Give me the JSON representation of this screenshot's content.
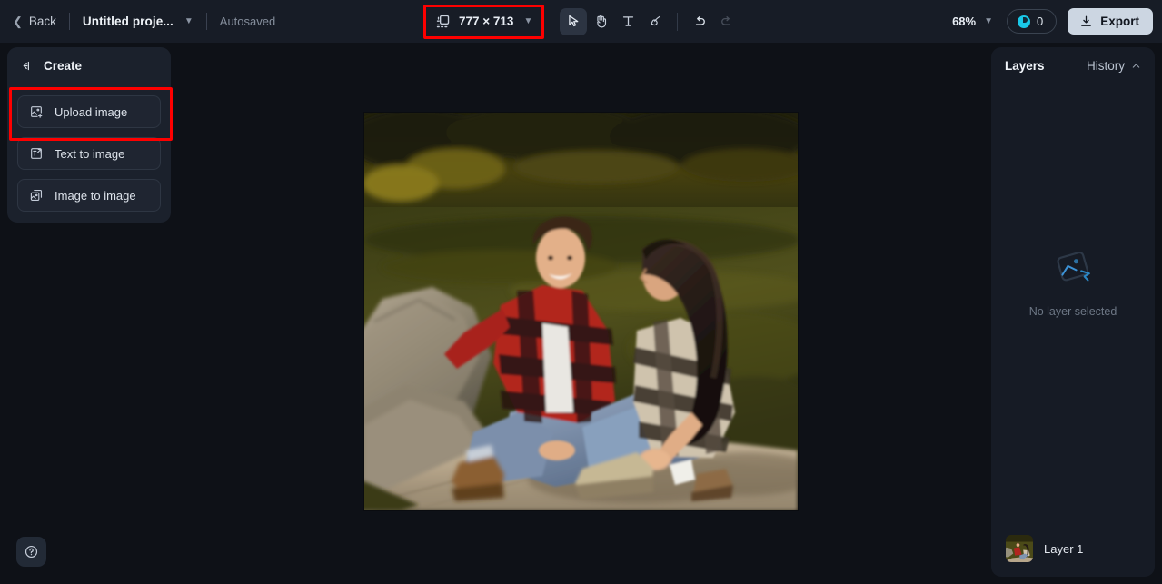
{
  "topbar": {
    "back_label": "Back",
    "project_name": "Untitled proje...",
    "autosave_label": "Autosaved",
    "canvas_size": "777 × 713",
    "zoom_level": "68%",
    "credits_count": "0",
    "export_label": "Export",
    "tools": [
      {
        "name": "select-tool",
        "label": "Select",
        "active": true
      },
      {
        "name": "hand-tool",
        "label": "Hand",
        "active": false
      },
      {
        "name": "text-tool",
        "label": "Text",
        "active": false
      },
      {
        "name": "brush-tool",
        "label": "Brush",
        "active": false
      },
      {
        "name": "undo-button",
        "label": "Undo",
        "active": false
      },
      {
        "name": "redo-button",
        "label": "Redo",
        "active": false
      }
    ]
  },
  "create_panel": {
    "title": "Create",
    "items": [
      {
        "label": "Upload image",
        "icon": "upload-image-icon"
      },
      {
        "label": "Text to image",
        "icon": "text-to-image-icon"
      },
      {
        "label": "Image to image",
        "icon": "image-to-image-icon"
      }
    ]
  },
  "layers_panel": {
    "layers_tab": "Layers",
    "history_tab": "History",
    "empty_text": "No layer selected",
    "layers": [
      {
        "name": "Layer 1"
      }
    ]
  },
  "help": {
    "label": "?"
  },
  "colors": {
    "accent_cyan": "#19c8e8",
    "annotation_red": "#fe0000",
    "panel_bg": "#1b212c",
    "topbar_bg": "#171c26",
    "canvas_bg": "#0e1117",
    "export_bg": "#ccd6e2"
  }
}
